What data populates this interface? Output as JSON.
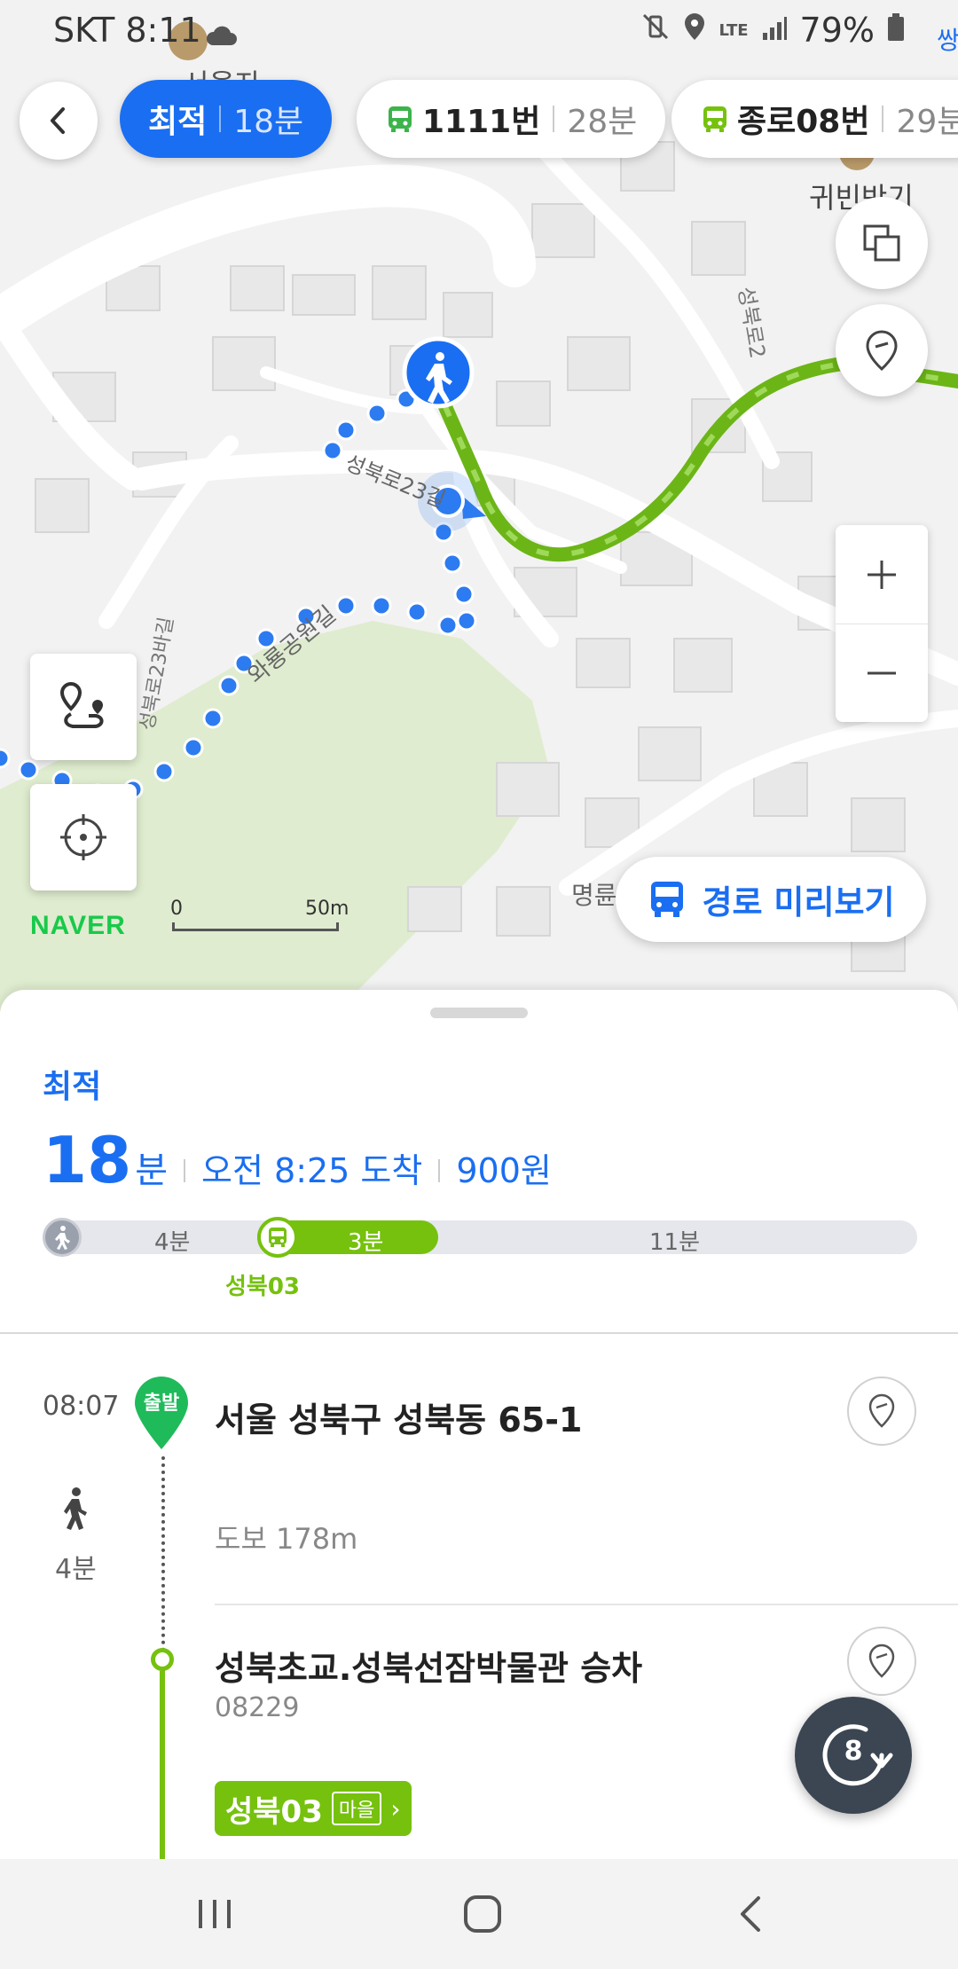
{
  "status_bar": {
    "carrier_time": "SKT 8:11",
    "network": "LTE",
    "battery": "79%"
  },
  "route_options": [
    {
      "label": "최적",
      "duration": "18분"
    },
    {
      "label": "1111번",
      "duration": "28분"
    },
    {
      "label": "종로08번",
      "duration": "29분"
    }
  ],
  "map": {
    "labels": {
      "top_place": "서울자",
      "right_place": "귀빈반기",
      "road_right": "성북로2",
      "road_center": "성북로23길",
      "park_road": "와룡공원길",
      "road_left": "성북로23바길",
      "bottom_road": "명륜",
      "edge_right": "쌍"
    },
    "logo": "NAVER",
    "scale_start": "0",
    "scale_end": "50m",
    "preview_button": "경로 미리보기"
  },
  "summary": {
    "label": "최적",
    "duration_value": "18",
    "duration_unit": "분",
    "arrival": "오전 8:25 도착",
    "fare": "900원"
  },
  "timeline": {
    "walk1": "4분",
    "bus": "3분",
    "walk2": "11분",
    "bus_name": "성북03"
  },
  "steps": {
    "start_time": "08:07",
    "start_marker": "출발",
    "start_address": "서울 성북구 성북동 65-1",
    "walk_minutes": "4분",
    "walk_distance": "도보 178m",
    "stop_name": "성북초교.성북선잠박물관 승차",
    "stop_id": "08229",
    "bus_number": "성북03",
    "bus_type": "마을"
  },
  "refresh_count": "8",
  "colors": {
    "accent": "#1a6ef2",
    "bus_green": "#76c10e",
    "naver_green": "#19c94a"
  }
}
